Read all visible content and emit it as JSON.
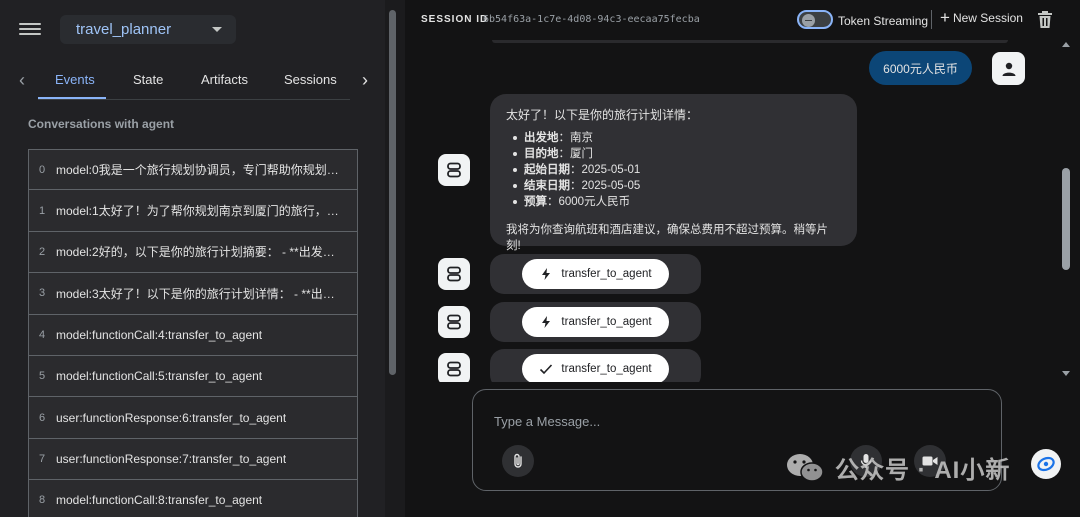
{
  "sidebar": {
    "app_select": {
      "value": "travel_planner"
    },
    "tabs": [
      {
        "label": "Events",
        "active": true
      },
      {
        "label": "State",
        "active": false
      },
      {
        "label": "Artifacts",
        "active": false
      },
      {
        "label": "Sessions",
        "active": false
      }
    ],
    "conversations_title": "Conversations with agent",
    "events": [
      {
        "index": "0",
        "text": "model:0我是一个旅行规划协调员，专门帮助你规划旅行…"
      },
      {
        "index": "1",
        "text": "model:1太好了！为了帮你规划南京到厦门的旅行，我需…"
      },
      {
        "index": "2",
        "text": "model:2好的，以下是你的旅行计划摘要： - **出发地**…"
      },
      {
        "index": "3",
        "text": "model:3太好了！以下是你的旅行计划详情： - **出发地…"
      },
      {
        "index": "4",
        "text": "model:functionCall:4:transfer_to_agent"
      },
      {
        "index": "5",
        "text": "model:functionCall:5:transfer_to_agent"
      },
      {
        "index": "6",
        "text": "user:functionResponse:6:transfer_to_agent"
      },
      {
        "index": "7",
        "text": "user:functionResponse:7:transfer_to_agent"
      },
      {
        "index": "8",
        "text": "model:functionCall:8:transfer_to_agent"
      }
    ]
  },
  "header": {
    "session_label": "SESSION ID",
    "session_id": "6b54f63a-1c7e-4d08-94c3-eecaa75fecba",
    "token_streaming_label": "Token Streaming",
    "token_streaming_on": false,
    "new_session_label": "New Session"
  },
  "chat": {
    "user_message": "6000元人民币",
    "bot_message": {
      "intro": "太好了！以下是你的旅行计划详情：",
      "items": [
        {
          "key": "出发地",
          "value": "：南京"
        },
        {
          "key": "目的地",
          "value": "：厦门"
        },
        {
          "key": "起始日期",
          "value": "：2025-05-01"
        },
        {
          "key": "结束日期",
          "value": "：2025-05-05"
        },
        {
          "key": "预算",
          "value": "：6000元人民币"
        }
      ],
      "outro": "我将为你查询航班和酒店建议，确保总费用不超过预算。稍等片刻!"
    },
    "function_calls": [
      {
        "label": "transfer_to_agent",
        "icon": "bolt-icon"
      },
      {
        "label": "transfer_to_agent",
        "icon": "bolt-icon"
      },
      {
        "label": "transfer_to_agent",
        "icon": "check-icon"
      }
    ]
  },
  "composer": {
    "placeholder": "Type a Message..."
  },
  "watermark": {
    "text": "公众号 · AI小新"
  },
  "colors": {
    "accent": "#8ab4f8",
    "user_bubble": "#0c4677",
    "bot_bubble": "#303034",
    "sidebar_bg": "#212124",
    "main_bg": "#131314"
  }
}
